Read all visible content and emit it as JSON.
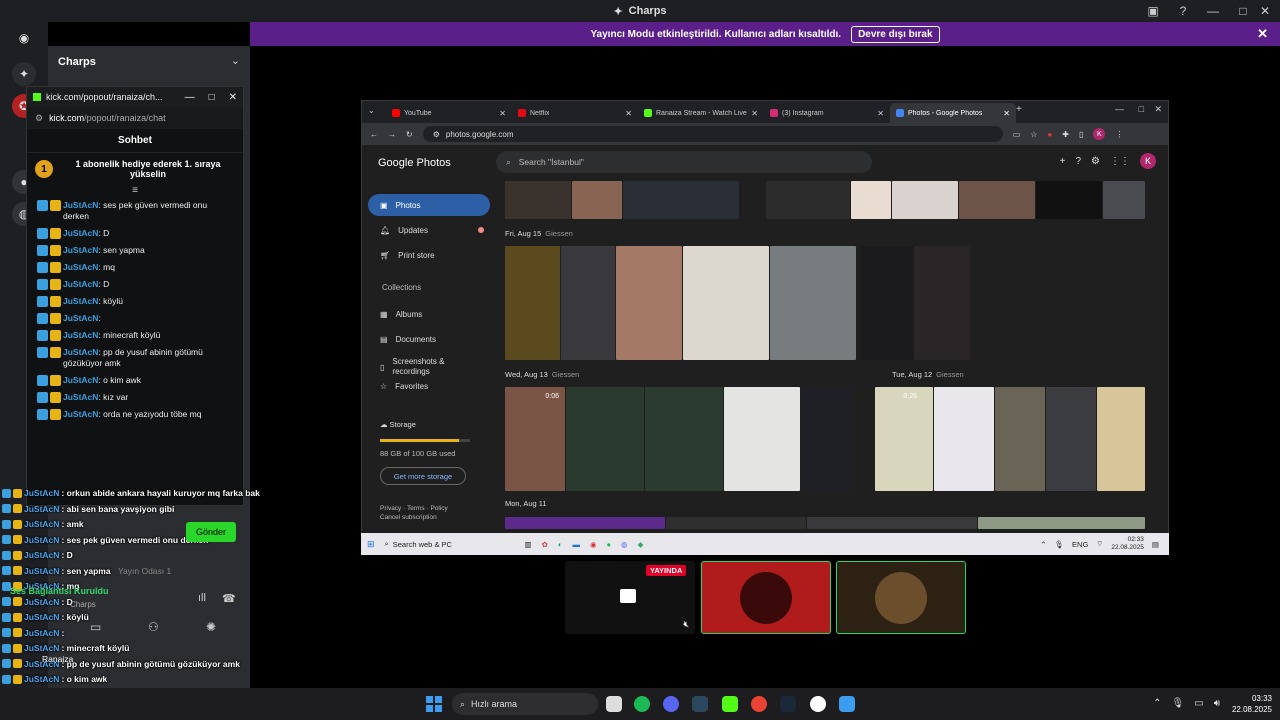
{
  "discord": {
    "app_title": "Charps",
    "server_name": "Charps",
    "banner_text": "Yayıncı Modu etkinleştirildi. Kullanıcı adları kısaltıldı.",
    "banner_button": "Devre dışı bırak"
  },
  "kick_popout": {
    "window_title": "kick.com/popout/ranaiza/ch...",
    "url_host": "kick.com",
    "url_path": "/popout/ranaiza/chat",
    "chat_title": "Sohbet",
    "promo_text": "1 abonelik hediye ederek 1. sıraya yükselin",
    "promo_rank": "1",
    "messages": [
      {
        "user": "JuStAcN",
        "text": ": ses pek güven vermedi onu derken"
      },
      {
        "user": "JuStAcN",
        "text": ": D"
      },
      {
        "user": "JuStAcN",
        "text": ": sen yapma"
      },
      {
        "user": "JuStAcN",
        "text": ": mq"
      },
      {
        "user": "JuStAcN",
        "text": ": D"
      },
      {
        "user": "JuStAcN",
        "text": ": köylü"
      },
      {
        "user": "JuStAcN",
        "text": ":"
      },
      {
        "user": "JuStAcN",
        "text": ": minecraft köylü"
      },
      {
        "user": "JuStAcN",
        "text": ": pp de yusuf abinin götümü gözüküyor amk"
      },
      {
        "user": "JuStAcN",
        "text": ": o kim awk"
      },
      {
        "user": "JuStAcN",
        "text": ": kız var"
      },
      {
        "user": "JuStAcN",
        "text": ": orda ne yazıyodu töbe mq"
      }
    ],
    "send_label": "Gönder"
  },
  "overlay_chat": [
    {
      "user": "JuStAcN",
      "text": ": orkun abide ankara hayali kuruyor mq farka bak"
    },
    {
      "user": "JuStAcN",
      "text": ": abi sen bana yavşiyon gibi"
    },
    {
      "user": "JuStAcN",
      "text": ": amk"
    },
    {
      "user": "JuStAcN",
      "text": ": ses pek güven vermedi onu derken"
    },
    {
      "user": "JuStAcN",
      "text": ": D"
    },
    {
      "user": "JuStAcN",
      "text": ": sen yapma"
    },
    {
      "user": "JuStAcN",
      "text": ": mq"
    },
    {
      "user": "JuStAcN",
      "text": ": D"
    },
    {
      "user": "JuStAcN",
      "text": ": köylü"
    },
    {
      "user": "JuStAcN",
      "text": ":"
    },
    {
      "user": "JuStAcN",
      "text": ": minecraft köylü"
    },
    {
      "user": "JuStAcN",
      "text": ": pp de yusuf abinin götümü gözüküyor amk"
    },
    {
      "user": "JuStAcN",
      "text": ": o kim awk"
    },
    {
      "user": "JuStAcN",
      "text": ": kız var"
    },
    {
      "user": "JuStAcN",
      "text": ": orda ne yazıyodu töbe mq"
    }
  ],
  "voice": {
    "status": "Ses Bağlantısı Kuruldu",
    "channel": "Charps",
    "room": "Yayın Odası 1",
    "user": "Ranaiza"
  },
  "chrome": {
    "tabs": [
      {
        "label": "YouTube",
        "color": "#ff0000"
      },
      {
        "label": "Netflix",
        "color": "#e50914"
      },
      {
        "label": "Ranaiza Stream - Watch Live o",
        "color": "#53fc18"
      },
      {
        "label": "(3) Instagram",
        "color": "#d62976"
      },
      {
        "label": "Photos - Google Photos",
        "color": "#4285f4"
      }
    ],
    "address": "photos.google.com"
  },
  "photos": {
    "logo": "Google Photos",
    "search_placeholder": "Search \"İstanbul\"",
    "avatar_letter": "K",
    "nav": [
      "Photos",
      "Updates",
      "Print store"
    ],
    "collections_header": "Collections",
    "collections": [
      "Albums",
      "Documents",
      "Screenshots & recordings",
      "Favorites"
    ],
    "storage_label": "Storage",
    "storage_used": "88 GB of 100 GB used",
    "storage_fraction": 0.88,
    "more_storage": "Get more storage",
    "footer_privacy": "Privacy",
    "footer_terms": "Terms",
    "footer_policy": "Policy",
    "footer_cancel": "Cancel subscription",
    "days": [
      {
        "date": "Fri, Aug 15",
        "place": "Giessen"
      },
      {
        "date": "Wed, Aug 13",
        "place": "Giessen"
      },
      {
        "date": "Tue, Aug 12",
        "place": "Giessen"
      },
      {
        "date": "Mon, Aug 11",
        "place": ""
      }
    ],
    "durations": [
      "0:06",
      "0:26"
    ]
  },
  "inner_taskbar": {
    "search": "Search web & PC",
    "lang": "ENG",
    "time": "02:33",
    "date": "22.08.2025"
  },
  "stream_tiles": {
    "live_badge": "YAYINDA"
  },
  "windows_taskbar": {
    "search": "Hızlı arama",
    "time": "03:33",
    "date": "22.08.2025"
  }
}
